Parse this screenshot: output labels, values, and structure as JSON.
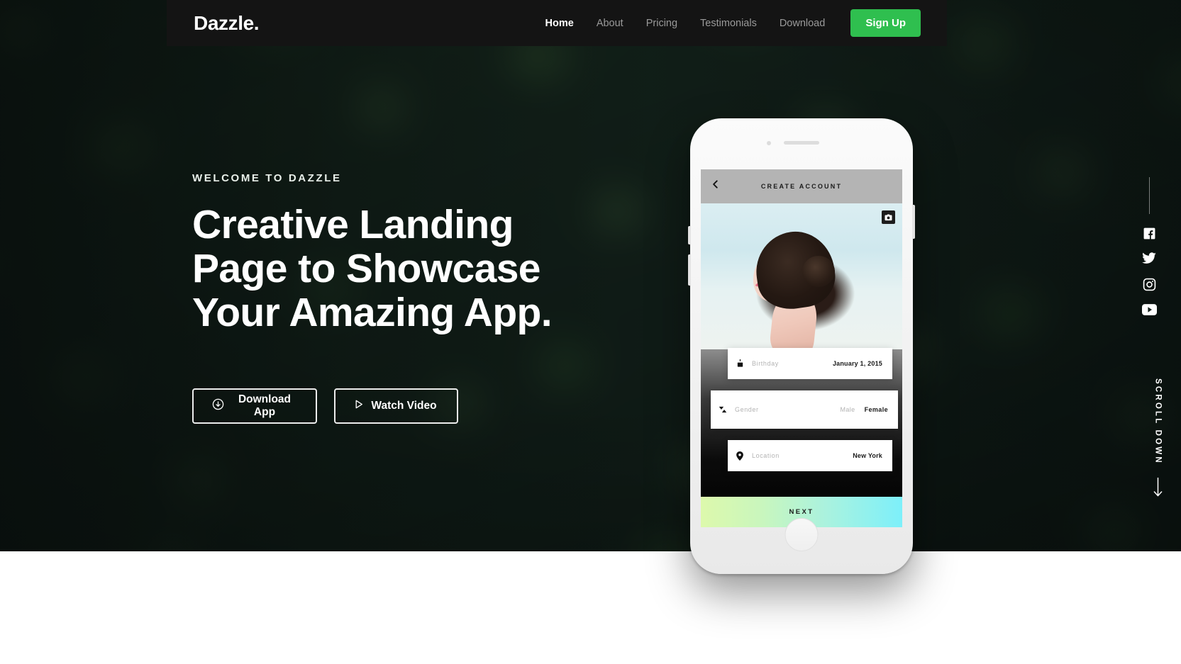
{
  "navbar": {
    "brand": "Dazzle.",
    "links": [
      {
        "label": "Home",
        "active": true
      },
      {
        "label": "About",
        "active": false
      },
      {
        "label": "Pricing",
        "active": false
      },
      {
        "label": "Testimonials",
        "active": false
      },
      {
        "label": "Download",
        "active": false
      }
    ],
    "signup_label": "Sign Up",
    "signup_color": "#2fbf4f",
    "background_color": "#141414"
  },
  "hero": {
    "eyebrow": "WELCOME TO DAZZLE",
    "headline": "Creative Landing Page to Showcase Your Amazing App.",
    "buttons": [
      {
        "label": "Download App",
        "icon": "download-circle-icon"
      },
      {
        "label": "Watch Video",
        "icon": "play-triangle-icon"
      }
    ]
  },
  "phone_app": {
    "back_icon": "chevron-left-icon",
    "title": "CREATE ACCOUNT",
    "camera_button_icon": "camera-icon",
    "fields": [
      {
        "icon": "cake-icon",
        "label": "Birthday",
        "value": "January 1, 2015"
      },
      {
        "icon": "gender-icon",
        "label": "Gender",
        "options": [
          "Male",
          "Female"
        ],
        "selected": "Female"
      },
      {
        "icon": "pin-icon",
        "label": "Location",
        "value": "New York"
      }
    ],
    "next_label": "NEXT",
    "next_gradient_from": "#ddf9ac",
    "next_gradient_to": "#7df0fa"
  },
  "social_rail": {
    "items": [
      {
        "name": "facebook",
        "icon": "facebook-icon"
      },
      {
        "name": "twitter",
        "icon": "twitter-icon"
      },
      {
        "name": "instagram",
        "icon": "instagram-icon"
      },
      {
        "name": "youtube",
        "icon": "youtube-icon"
      }
    ]
  },
  "scroll_indicator": {
    "label": "SCROLL DOWN",
    "icon": "arrow-down-icon"
  }
}
